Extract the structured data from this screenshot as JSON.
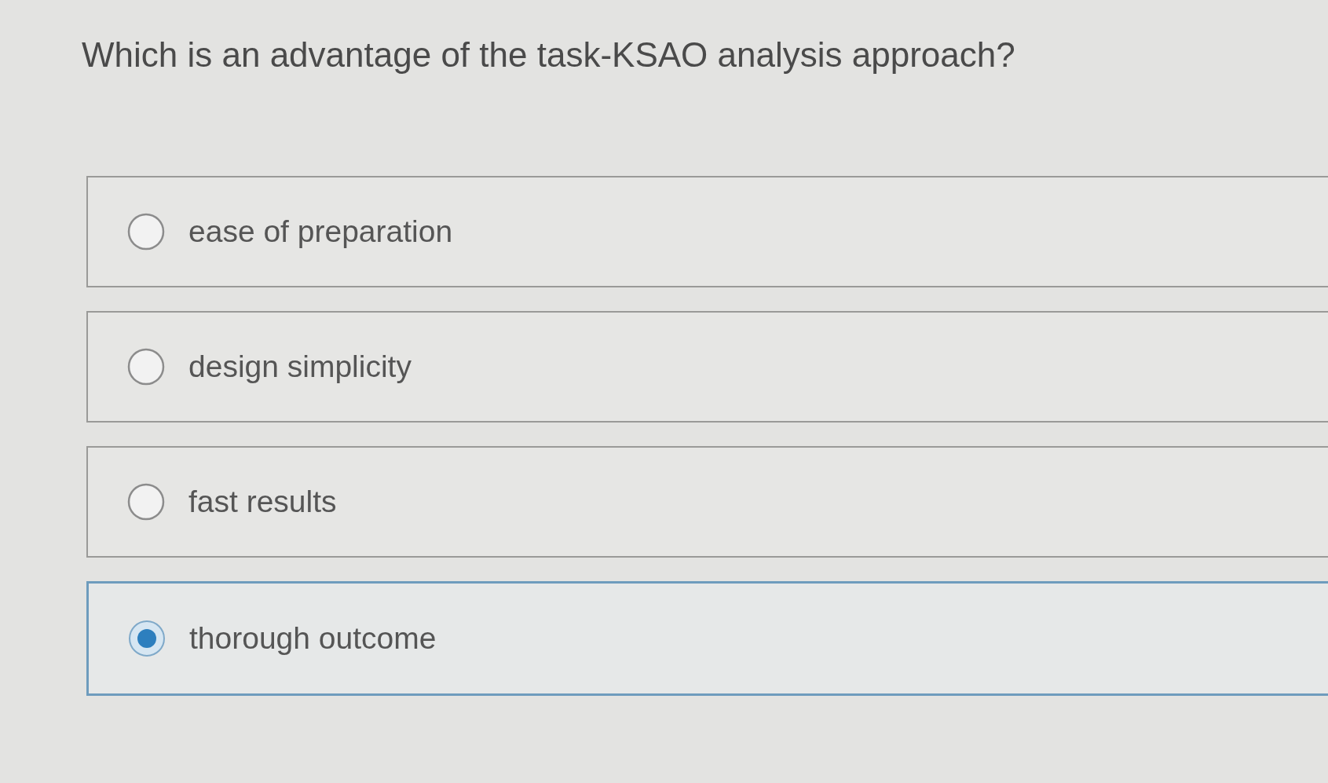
{
  "question": "Which is an advantage of the task-KSAO analysis approach?",
  "options": [
    {
      "label": "ease of preparation",
      "selected": false
    },
    {
      "label": "design simplicity",
      "selected": false
    },
    {
      "label": "fast results",
      "selected": false
    },
    {
      "label": "thorough outcome",
      "selected": true
    }
  ]
}
